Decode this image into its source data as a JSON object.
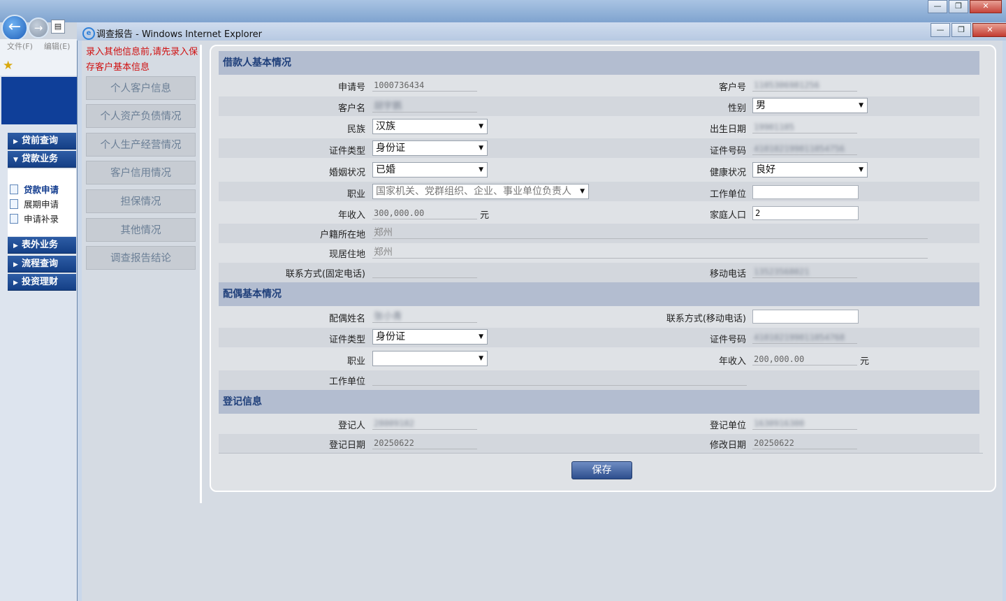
{
  "outer_window": {
    "menu": [
      "文件(F)",
      "编辑(E)"
    ],
    "nav": {
      "heads": [
        "贷前查询",
        "贷款业务",
        "表外业务",
        "流程查询",
        "投资理财"
      ],
      "sub_items": [
        "贷款申请",
        "展期申请",
        "申请补录"
      ]
    }
  },
  "ie_window": {
    "title": "调查报告 - Windows Internet Explorer"
  },
  "notice": "录入其他信息前,请先录入保存客户基本信息",
  "side_tabs": [
    "个人客户信息",
    "个人资产负债情况",
    "个人生产经营情况",
    "客户信用情况",
    "担保情况",
    "其他情况",
    "调查报告结论"
  ],
  "sections": {
    "borrower": "借款人基本情况",
    "spouse": "配偶基本情况",
    "register": "登记信息"
  },
  "borrower": {
    "app_no_label": "申请号",
    "app_no": "1000736434",
    "cust_no_label": "客户号",
    "cust_no": "1105306981256",
    "cust_name_label": "客户名",
    "cust_name": "胡宇鹏",
    "gender_label": "性别",
    "gender": "男",
    "ethnic_label": "民族",
    "ethnic": "汉族",
    "birth_label": "出生日期",
    "birth": "19901105",
    "id_type_label": "证件类型",
    "id_type": "身份证",
    "id_no_label": "证件号码",
    "id_no": "410102199011054756",
    "marital_label": "婚姻状况",
    "marital": "已婚",
    "health_label": "健康状况",
    "health": "良好",
    "job_label": "职业",
    "job": "国家机关、党群组织、企业、事业单位负责人",
    "employer_label": "工作单位",
    "employer": "",
    "income_label": "年收入",
    "income": "300,000.00",
    "income_unit": "元",
    "family_label": "家庭人口",
    "family": "2",
    "household_label": "户籍所在地",
    "household": "郑州",
    "residence_label": "现居住地",
    "residence": "郑州",
    "phone_label": "联系方式(固定电话)",
    "phone": "",
    "mobile_label": "移动电话",
    "mobile": "13523568021"
  },
  "spouse": {
    "name_label": "配偶姓名",
    "name": "张小青",
    "contact_label": "联系方式(移动电话)",
    "contact": "",
    "id_type_label": "证件类型",
    "id_type": "身份证",
    "id_no_label": "证件号码",
    "id_no": "410102199011054768",
    "job_label": "职业",
    "job": "",
    "income_label": "年收入",
    "income": "200,000.00",
    "income_unit": "元",
    "employer_label": "工作单位",
    "employer": ""
  },
  "register": {
    "person_label": "登记人",
    "person": "28009102",
    "unit_label": "登记单位",
    "unit": "1630916300",
    "date_label": "登记日期",
    "date": "20250622",
    "modify_label": "修改日期",
    "modify": "20250622"
  },
  "save_label": "保存"
}
